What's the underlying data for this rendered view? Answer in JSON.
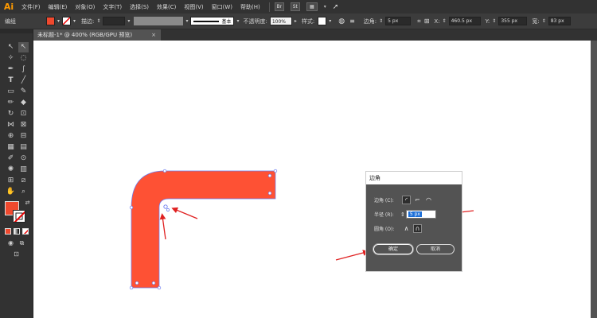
{
  "app": {
    "logo": "Ai"
  },
  "menu": {
    "items": [
      "文件(F)",
      "编辑(E)",
      "对象(O)",
      "文字(T)",
      "选择(S)",
      "效果(C)",
      "视图(V)",
      "窗口(W)",
      "帮助(H)"
    ],
    "br_label": "Br",
    "st_label": "St"
  },
  "control_bar": {
    "selection_label": "编组",
    "stroke_label": "描边:",
    "stroke_profile": "基本",
    "opacity_label": "不透明度:",
    "opacity_value": "100%",
    "style_label": "样式:",
    "corner_label": "边角:",
    "corner_value": "5 px",
    "x_label": "X:",
    "x_value": "460.5 px",
    "y_label": "Y:",
    "y_value": "355 px",
    "w_label": "宽:",
    "w_value": "83 px",
    "fill_color": "#f0492e"
  },
  "document": {
    "tab_title": "未标题-1* @ 400% (RGB/GPU 预览)",
    "close_glyph": "×"
  },
  "shape": {
    "fill_color": "#fe5134",
    "anchor_color": "#6a7cf0",
    "arrow_color": "#e02121"
  },
  "dialog": {
    "title": "边角",
    "corner_label": "边角 (C):",
    "radius_label": "半径 (R):",
    "radius_value": "5 px",
    "round_label": "圆角 (O):",
    "ok_label": "确定",
    "cancel_label": "取消"
  }
}
